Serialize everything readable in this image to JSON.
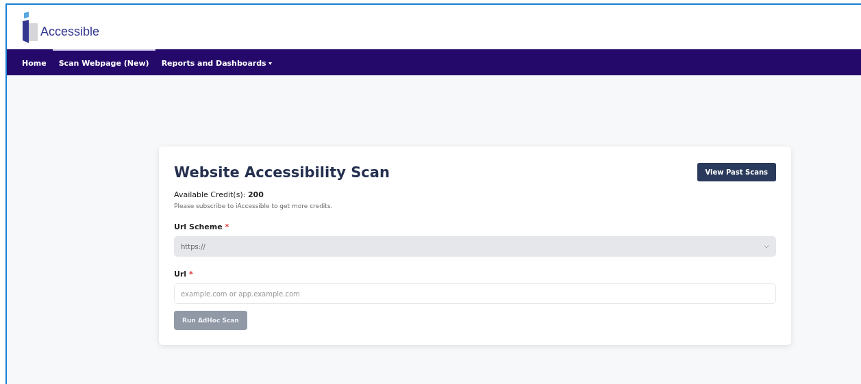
{
  "logo": {
    "text": "Accessible"
  },
  "nav": [
    {
      "label": "Home",
      "selected": false,
      "dropdown": false
    },
    {
      "label": "Scan Webpage (New)",
      "selected": true,
      "dropdown": false
    },
    {
      "label": "Reports and Dashboards",
      "selected": false,
      "dropdown": true
    }
  ],
  "card": {
    "title": "Website Accessibility Scan",
    "action_button": "View Past Scans",
    "credits_label": "Available Credit(s): ",
    "credits_value": "200",
    "note": "Please subscribe to iAccessible to get more credits.",
    "fields": [
      {
        "kind": "select",
        "label": "Url Scheme",
        "required_mark": "*",
        "value": "https://"
      },
      {
        "kind": "input",
        "label": "Url",
        "required_mark": "*",
        "placeholder": "example.com or app.example.com"
      }
    ],
    "submit": {
      "label": "Run AdHoc Scan",
      "disabled": true
    }
  }
}
